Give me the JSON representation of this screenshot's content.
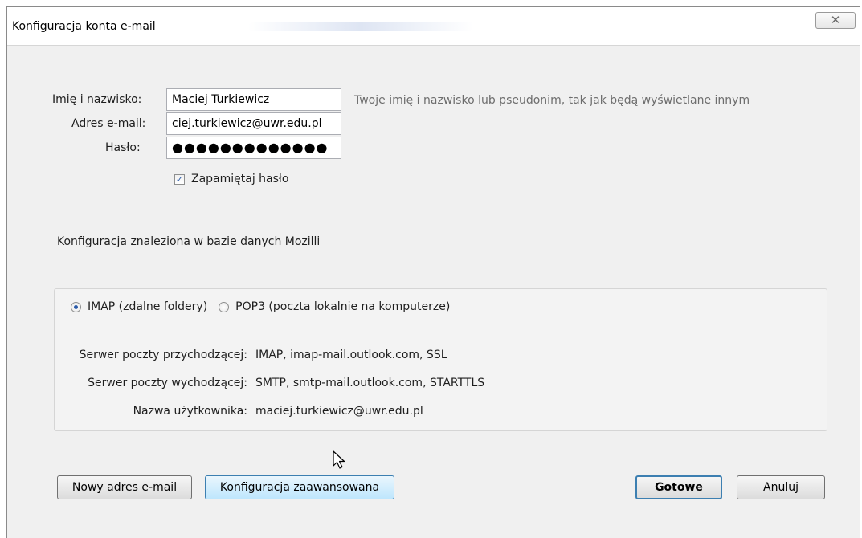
{
  "window": {
    "title": "Konfiguracja konta e-mail"
  },
  "form": {
    "name_label": "Imię i nazwisko:",
    "name_value": "Maciej Turkiewicz",
    "name_hint": "Twoje imię i nazwisko lub pseudonim, tak jak będą wyświetlane innym",
    "email_label": "Adres e-mail:",
    "email_value": "ciej.turkiewicz@uwr.edu.pl",
    "password_label": "Hasło:",
    "password_value": "●●●●●●●●●●●●●",
    "remember_label": "Zapamiętaj hasło"
  },
  "found_text": "Konfiguracja znaleziona w bazie danych Mozilli",
  "protocols": {
    "imap_label": "IMAP (zdalne foldery)",
    "pop3_label": "POP3 (poczta lokalnie na komputerze)",
    "selected": "IMAP"
  },
  "server_info": [
    {
      "label": "Serwer poczty przychodzącej:",
      "value": "IMAP, imap-mail.outlook.com, SSL"
    },
    {
      "label": "Serwer poczty wychodzącej:",
      "value": "SMTP, smtp-mail.outlook.com, STARTTLS"
    },
    {
      "label": "Nazwa użytkownika:",
      "value": "maciej.turkiewicz@uwr.edu.pl"
    }
  ],
  "buttons": {
    "new_address": "Nowy adres e-mail",
    "advanced_config": "Konfiguracja zaawansowana",
    "done": "Gotowe",
    "cancel": "Anuluj"
  },
  "icons": {
    "close": "close-icon",
    "cursor": "mouse-cursor-icon"
  }
}
